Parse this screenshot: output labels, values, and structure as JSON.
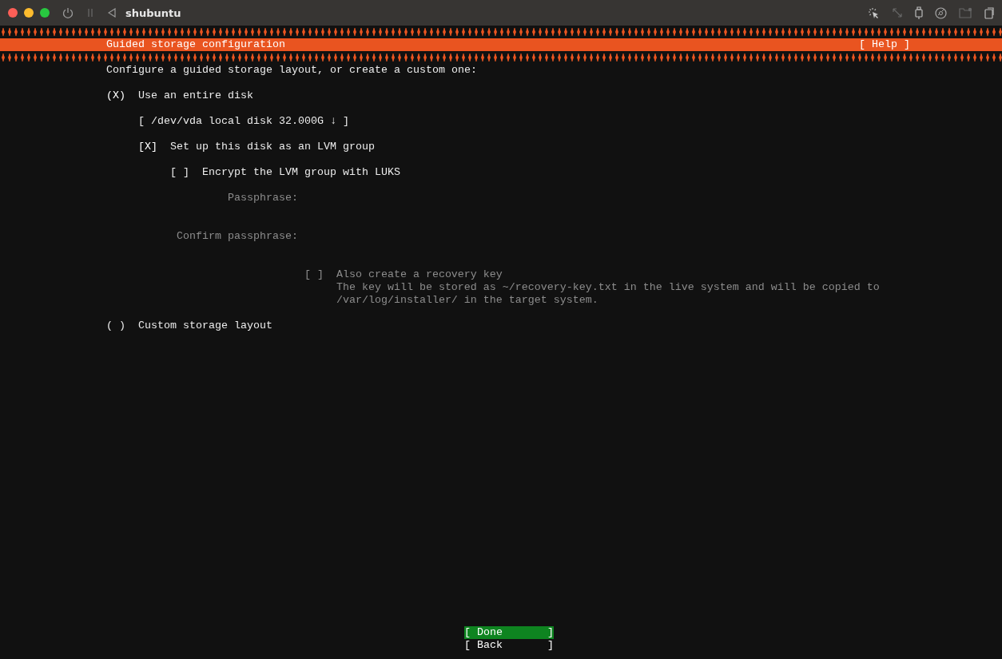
{
  "window": {
    "title": "shubuntu"
  },
  "header": {
    "title": "Guided storage configuration",
    "help": "[ Help ]"
  },
  "intro": "Configure a guided storage layout, or create a custom one:",
  "options": [
    {
      "kind": "radio",
      "mark": "(X)",
      "label": "Use an entire disk",
      "selected": true,
      "children": [
        {
          "kind": "dropdown",
          "label": "[ /dev/vda local disk 32.000G ↓ ]"
        },
        {
          "kind": "checkbox",
          "mark": "[X]",
          "label": "Set up this disk as an LVM group",
          "checked": true,
          "children": [
            {
              "kind": "checkbox",
              "mark": "[ ]",
              "label": "Encrypt the LVM group with LUKS",
              "checked": false,
              "children": [
                {
                  "kind": "field",
                  "label": "Passphrase:",
                  "disabled": true
                },
                {
                  "kind": "field",
                  "label": "Confirm passphrase:",
                  "disabled": true
                },
                {
                  "kind": "subcheckbox",
                  "mark": "[ ]",
                  "label": "Also create a recovery key",
                  "note": "The key will be stored as ~/recovery-key.txt in the live system and will be copied to /var/log/installer/ in the target system.",
                  "checked": false,
                  "disabled": true
                }
              ]
            }
          ]
        }
      ]
    },
    {
      "kind": "radio",
      "mark": "( )",
      "label": "Custom storage layout",
      "selected": false
    }
  ],
  "buttons": [
    {
      "label": "[ Done       ]",
      "selected": true
    },
    {
      "label": "[ Back       ]",
      "selected": false
    }
  ]
}
